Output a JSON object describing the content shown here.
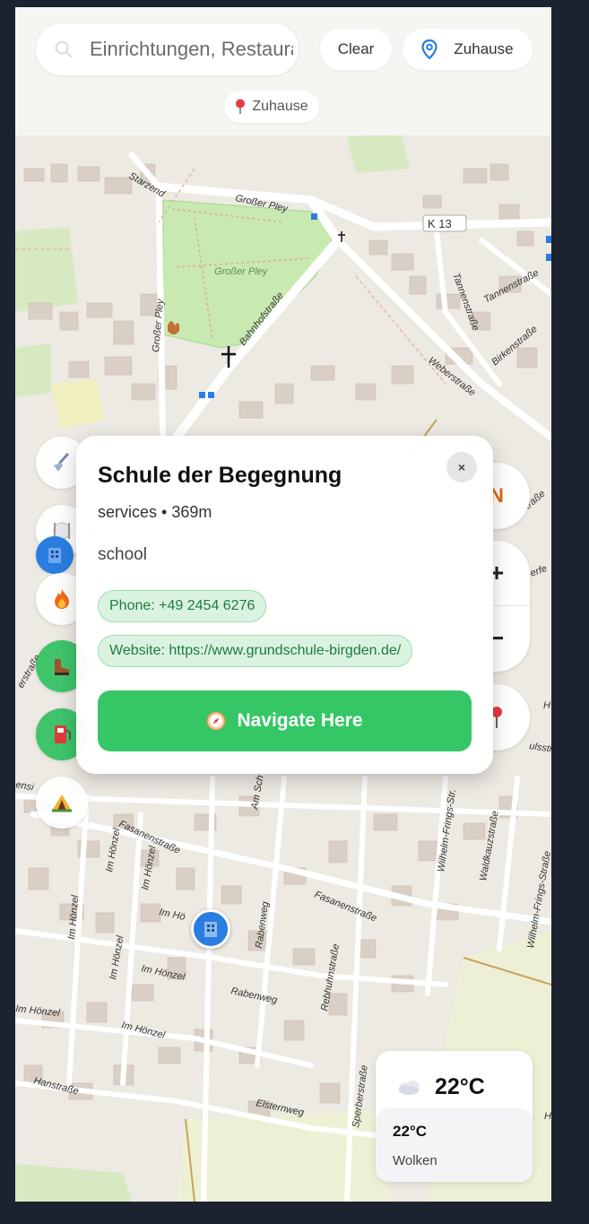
{
  "search": {
    "placeholder": "Einrichtungen, Restaurants"
  },
  "header": {
    "clear_label": "Clear",
    "home_label": "Zuhause",
    "home_chip_label": "Zuhause"
  },
  "map": {
    "street_labels": [
      "Starzend",
      "Großer Pley",
      "K 13",
      "Großer Pley",
      "Großer Pley",
      "Bahnhofstraße",
      "Tannenstraße",
      "Tannenstraße",
      "Birkenstraße",
      "Weberstraße",
      "Fasanenstraße",
      "Am Sch",
      "Wilhelm-Frings-Str.",
      "Waldkauzstraße",
      "Wilhelm-Frings-Straße",
      "Im Hönzel",
      "Im Hönzel",
      "Im Hö",
      "Im Hönzel",
      "Im Hönzel",
      "Im Hönzel",
      "Im Hönzel",
      "Rabenweg",
      "Rabenweg",
      "Rebhuhnstraße",
      "Fasanenstraße",
      "Sperberstraße",
      "Elsternweg",
      "Hanstraße",
      "Im Hönzel",
      "erstraße",
      "ensi",
      "erfe",
      "ulssti",
      "traße",
      "H",
      "H"
    ]
  },
  "side_buttons": [
    "broom-icon",
    "utensils-icon",
    "building-icon",
    "fire-icon",
    "hiking-boot-icon",
    "fuel-icon",
    "camping-icon"
  ],
  "controls": {
    "compass_label": "N",
    "zoom_in": "+",
    "zoom_out": "−"
  },
  "popup": {
    "title": "Schule der Begegnung",
    "meta": "services • 369m",
    "type": "school",
    "phone": "Phone: +49 2454 6276",
    "website": "Website: https://www.grundschule-birgden.de/",
    "close": "×",
    "navigate_label": "Navigate Here"
  },
  "weather": {
    "temp_main": "22°C",
    "temp_detail": "22°C",
    "description": "Wolken"
  },
  "colors": {
    "accent_green": "#35c765",
    "map_bg": "#ede9e3",
    "park": "#c8eab0",
    "primary_blue": "#2a7de1"
  }
}
